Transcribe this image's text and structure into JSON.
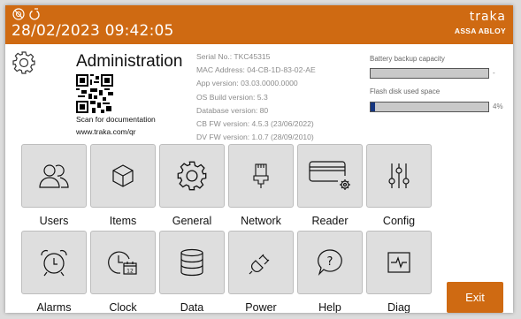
{
  "header": {
    "datetime": "28/02/2023 09:42:05",
    "brand_name": "traka",
    "brand_sub": "ASSA ABLOY",
    "status_icons": [
      "no-camera-icon",
      "power-icon"
    ],
    "color": "#cf6a12"
  },
  "admin": {
    "title": "Administration",
    "scan_text": "Scan for documentation",
    "url": "www.traka.com/qr"
  },
  "info": [
    "Serial No.:  TKC45315",
    "MAC Address: 04-CB-1D-83-02-AE",
    "App version:  03.03.0000.0000",
    "OS Build version:  5.3",
    "Database version: 80",
    "CB FW version: 4.5.3 (23/06/2022)",
    "DV FW version: 1.0.7 (28/09/2010)"
  ],
  "stats": {
    "battery_label": "Battery backup capacity",
    "battery_value": "-",
    "battery_fraction": 0,
    "flash_label": "Flash disk used space",
    "flash_value": "4%",
    "flash_fraction": 0.04
  },
  "tiles": [
    {
      "label": "Users",
      "icon": "users-icon"
    },
    {
      "label": "Items",
      "icon": "cube-icon"
    },
    {
      "label": "General",
      "icon": "gear-icon"
    },
    {
      "label": "Network",
      "icon": "ethernet-icon"
    },
    {
      "label": "Reader",
      "icon": "card-reader-icon"
    },
    {
      "label": "Config",
      "icon": "sliders-icon"
    },
    {
      "label": "Alarms",
      "icon": "alarm-clock-icon"
    },
    {
      "label": "Clock",
      "icon": "clock-calendar-icon"
    },
    {
      "label": "Data",
      "icon": "database-icon"
    },
    {
      "label": "Power",
      "icon": "plug-icon"
    },
    {
      "label": "Help",
      "icon": "help-icon"
    },
    {
      "label": "Diag",
      "icon": "diagnostics-icon"
    }
  ],
  "exit_label": "Exit"
}
